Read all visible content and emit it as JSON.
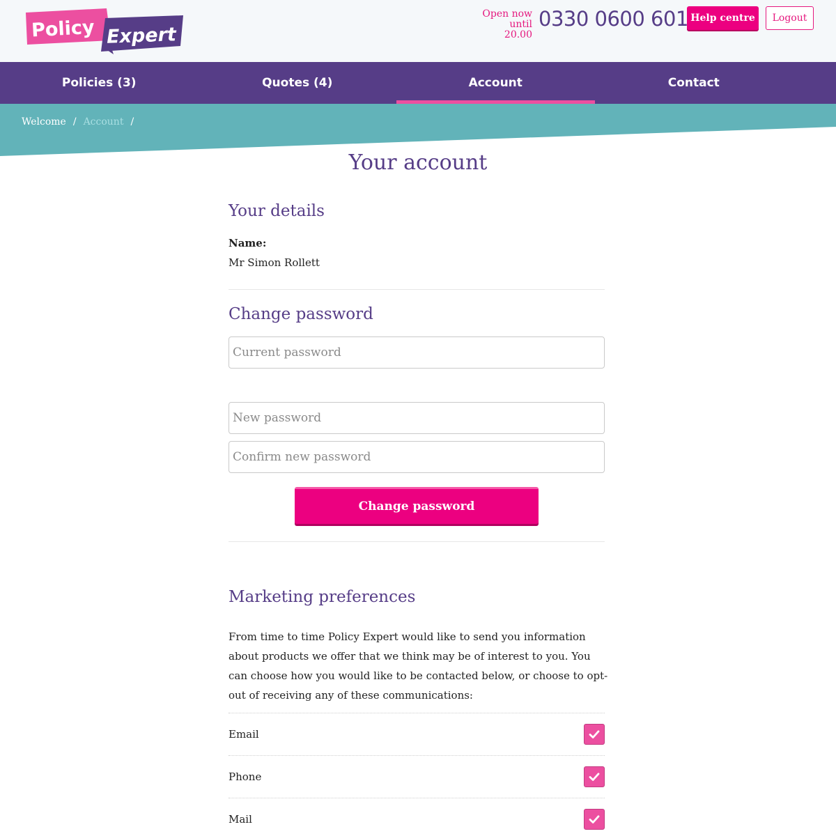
{
  "header": {
    "logo_text_1": "Policy",
    "logo_text_2": "Expert",
    "open_line1": "Open now",
    "open_line2": "until 20.00",
    "phone": "0330 0600 601",
    "help_label": "Help centre",
    "logout_label": "Logout"
  },
  "nav": {
    "items": [
      {
        "label": "Policies (3)"
      },
      {
        "label": "Quotes (4)"
      },
      {
        "label": "Account"
      },
      {
        "label": "Contact"
      }
    ]
  },
  "breadcrumb": {
    "items": [
      "Welcome",
      "Account"
    ],
    "separator": "/"
  },
  "main": {
    "title": "Your account",
    "details": {
      "title": "Your details",
      "name_label": "Name:",
      "name_value": "Mr Simon Rollett"
    },
    "password": {
      "title": "Change password",
      "current_placeholder": "Current password",
      "new_placeholder": "New password",
      "confirm_placeholder": "Confirm new password",
      "button_label": "Change password"
    },
    "marketing": {
      "title": "Marketing preferences",
      "text": "From time to time Policy Expert would like to send you information about products we offer that we think may be of interest to you. You can choose how you would like to be contacted below, or choose to opt-out of receiving any of these communications:",
      "options": [
        {
          "label": "Email",
          "checked": true
        },
        {
          "label": "Phone",
          "checked": true
        },
        {
          "label": "Mail",
          "checked": true
        }
      ]
    }
  },
  "colors": {
    "brand_purple": "#563d87",
    "brand_pink": "#ec0080",
    "teal": "#62b3b9",
    "checkbox_pink": "#ec4fa0"
  },
  "icons": {
    "checkbox": "checkmark-icon",
    "logo": "policy-expert-logo"
  }
}
